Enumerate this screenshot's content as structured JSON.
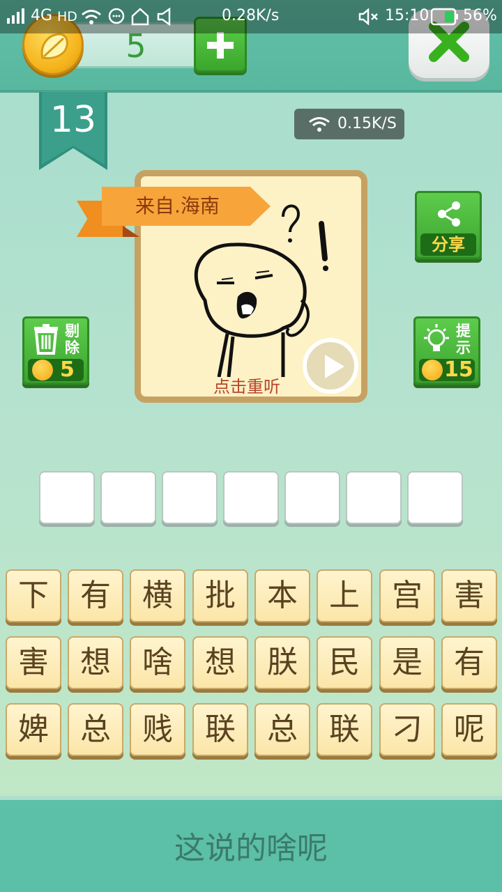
{
  "status_bar": {
    "network": "4G",
    "hd": "HD",
    "speed": "0.28K/s",
    "time": "15:10",
    "battery": "56%"
  },
  "header": {
    "coins": "5"
  },
  "level": "13",
  "net_speed": "0.15K/S",
  "card": {
    "source_tag": "来自.海南",
    "replay_hint": "点击重听"
  },
  "buttons": {
    "share_label": "分享",
    "remove_label_1": "剔",
    "remove_label_2": "除",
    "remove_cost": "5",
    "hint_label_1": "提",
    "hint_label_2": "示",
    "hint_cost": "15"
  },
  "answer_slot_count": 7,
  "tiles": [
    [
      "下",
      "有",
      "横",
      "批",
      "本",
      "上",
      "宫",
      "害"
    ],
    [
      "害",
      "想",
      "啥",
      "想",
      "朕",
      "民",
      "是",
      "有"
    ],
    [
      "婢",
      "总",
      "贱",
      "联",
      "总",
      "联",
      "刁",
      "呢"
    ]
  ],
  "footer_text": "这说的啥呢"
}
